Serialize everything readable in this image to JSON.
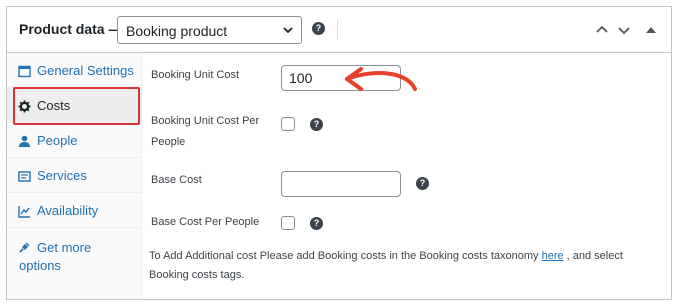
{
  "header": {
    "title": "Product data —",
    "product_type": "Booking product"
  },
  "sidebar": {
    "items": [
      {
        "label": "General Settings",
        "icon": "general-settings-icon"
      },
      {
        "label": "Costs",
        "icon": "gear-icon"
      },
      {
        "label": "People",
        "icon": "person-icon"
      },
      {
        "label": "Services",
        "icon": "services-icon"
      },
      {
        "label": "Availability",
        "icon": "availability-icon"
      },
      {
        "label_line1": "Get more",
        "label_line2": "options",
        "icon": "plug-icon"
      }
    ]
  },
  "costs": {
    "booking_unit_cost_label": "Booking Unit Cost",
    "booking_unit_cost_value": "100",
    "booking_unit_cost_per_people_label_line1": "Booking Unit Cost Per",
    "booking_unit_cost_per_people_label_line2": "People",
    "booking_unit_cost_per_people_checked": false,
    "base_cost_label": "Base Cost",
    "base_cost_value": "",
    "base_cost_per_people_label": "Base Cost Per People",
    "base_cost_per_people_checked": false,
    "note_prefix": "To Add Additional cost Please add Booking costs in the Booking costs taxonomy ",
    "note_link": "here",
    "note_suffix": " , and select",
    "note_line2": "Booking costs tags."
  },
  "colors": {
    "accent_link": "#2271b1",
    "highlight_border": "#d63638",
    "arrow": "#e8402a"
  }
}
